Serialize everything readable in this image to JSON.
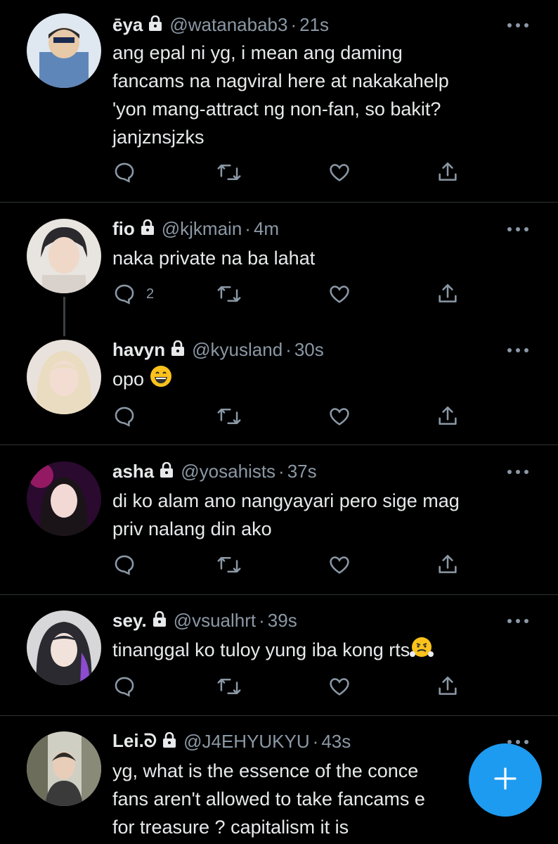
{
  "tweets": [
    {
      "name": "ēya",
      "handle": "@watanabab3",
      "dot": "·",
      "time": "21s",
      "text": "ang epal ni yg, i mean ang daming\nfancams na nagviral here at nakakahelp\n'yon mang-attract ng non-fan, so bakit?\njanjznsjzks",
      "reply_count": ""
    },
    {
      "name": "fio",
      "handle": "@kjkmain",
      "dot": "·",
      "time": "4m",
      "text": "naka private na ba lahat",
      "reply_count": "2"
    },
    {
      "name": "havyn",
      "handle": "@kyusland",
      "dot": "·",
      "time": "30s",
      "text": "opo ",
      "reply_count": ""
    },
    {
      "name": "asha",
      "handle": "@yosahists",
      "dot": "·",
      "time": "37s",
      "text": "di ko alam ano nangyayari pero sige mag\npriv nalang din ako",
      "reply_count": ""
    },
    {
      "name": "sey.",
      "handle": "@vsualhrt",
      "dot": "·",
      "time": "39s",
      "text": "tinanggal ko tuloy yung iba kong rts",
      "reply_count": ""
    },
    {
      "name": "Lei.ᘐ",
      "handle": "@J4EHYUKYU",
      "dot": "·",
      "time": "43s",
      "text": "yg, what is the essence of the conce\nfans aren't allowed to take fancams e\nfor treasure ? capitalism it is",
      "reply_count": ""
    }
  ],
  "icons": {
    "reply": "reply-icon",
    "retweet": "retweet-icon",
    "like": "heart-icon",
    "share": "share-icon",
    "lock": "lock-icon",
    "more": "more-icon",
    "compose": "plus-icon"
  },
  "colors": {
    "accent": "#1d9bf0",
    "muted": "#8b98a5",
    "text": "#e7e9ea",
    "background": "#000000"
  }
}
